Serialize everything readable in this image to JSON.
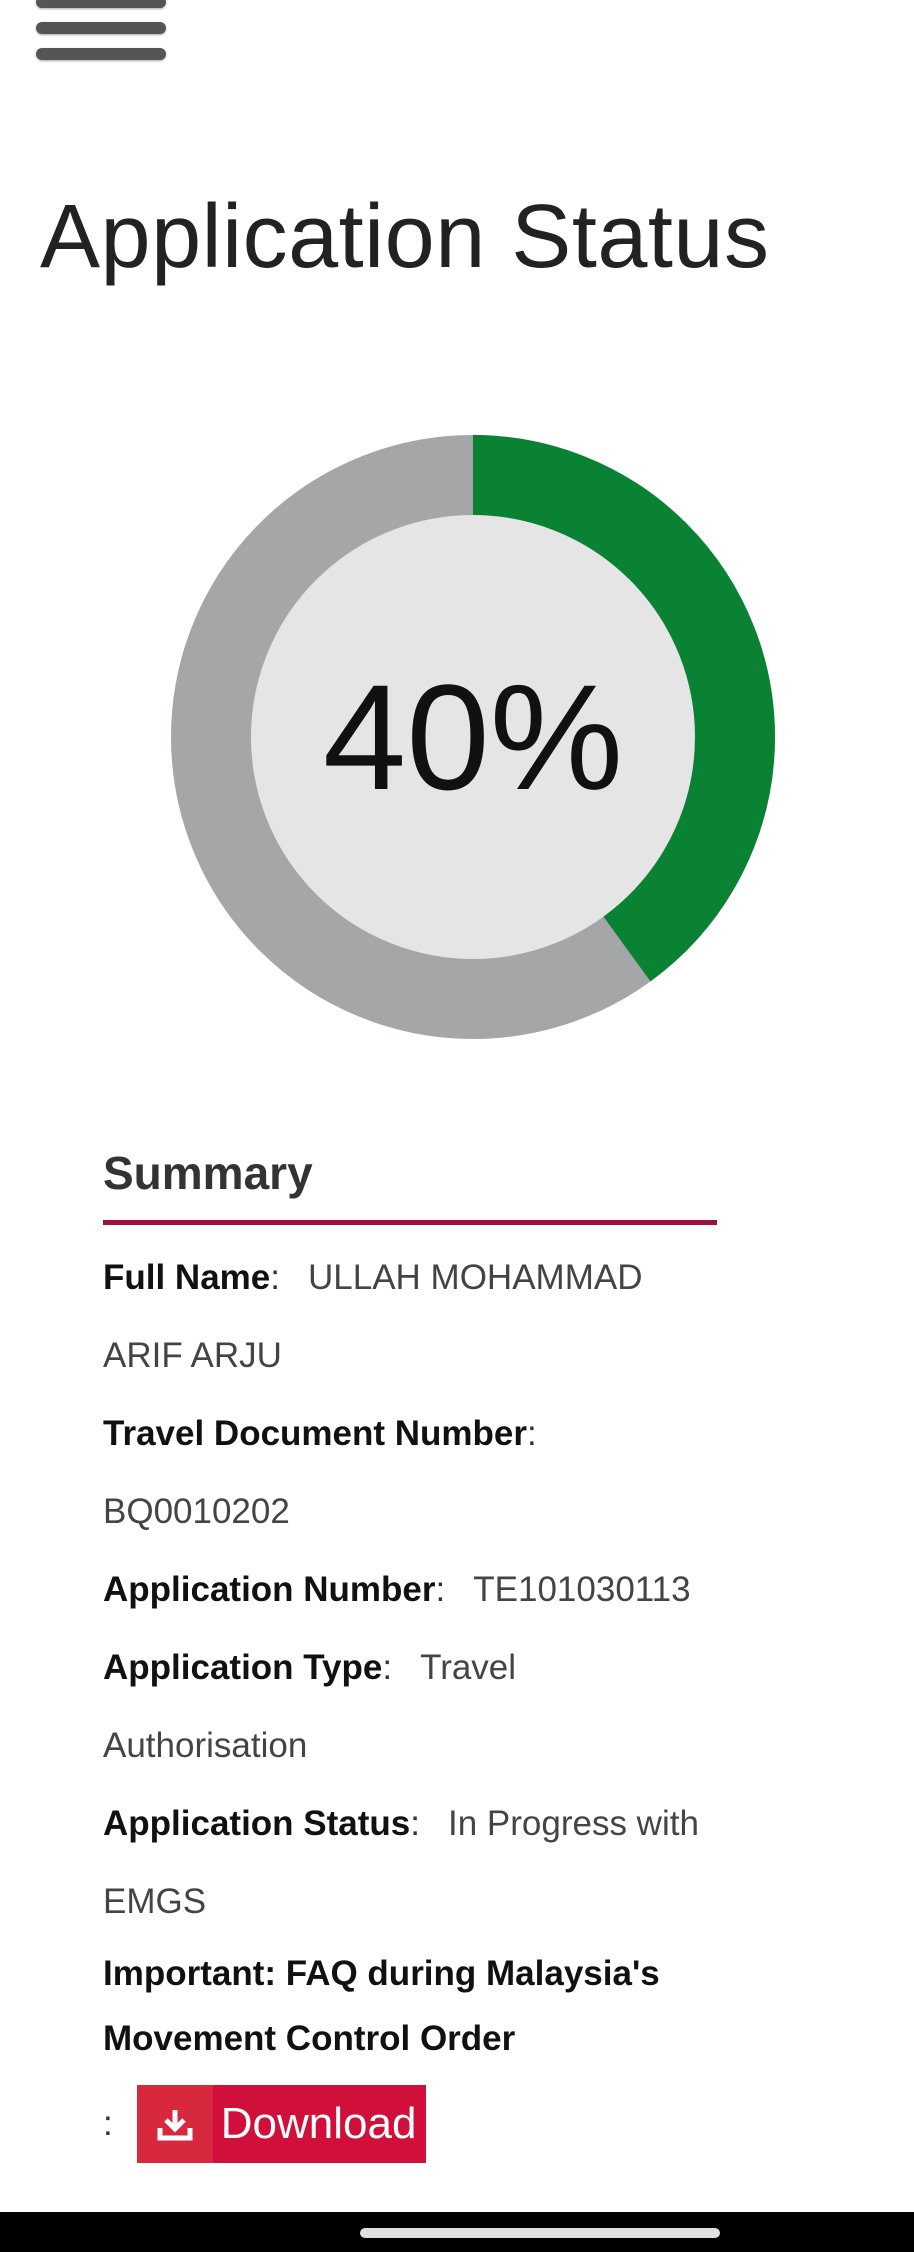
{
  "header": {
    "menu_icon": "hamburger-menu-icon"
  },
  "page_title": "Application Status",
  "progress": {
    "percent": 40,
    "label": "40%",
    "colors": {
      "filled": "#0a8234",
      "remaining": "#a4a6a8",
      "inner": "#e5e5e5"
    }
  },
  "summary": {
    "heading": "Summary",
    "accent_color": "#a1123a",
    "fields": {
      "full_name": {
        "label": "Full Name",
        "value": "ULLAH MOHAMMAD ARIF ARJU"
      },
      "travel_document_number": {
        "label": "Travel Document Number",
        "value": "BQ0010202"
      },
      "application_number": {
        "label": "Application Number",
        "value": "TE101030113"
      },
      "application_type": {
        "label": "Application Type",
        "value": "Travel Authorisation"
      },
      "application_status": {
        "label": "Application Status",
        "value": "In Progress with EMGS"
      }
    },
    "important": {
      "line1": "Important: FAQ during Malaysia's",
      "line2": "Movement Control Order"
    },
    "download": {
      "label": "Download",
      "icon": "download-icon",
      "color": "#d0103a"
    }
  }
}
